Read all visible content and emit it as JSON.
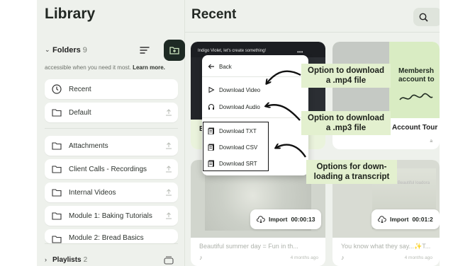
{
  "sidebar": {
    "title": "Library",
    "folders_label": "Folders",
    "folders_count": "9",
    "accessible_prefix": "accessible when you need it most. ",
    "accessible_link": "Learn more.",
    "items": [
      {
        "label": "Recent"
      },
      {
        "label": "Default"
      },
      {
        "label": "Attachments"
      },
      {
        "label": "Client Calls - Recordings"
      },
      {
        "label": "Internal Videos"
      },
      {
        "label": "Module 1: Baking Tutorials"
      },
      {
        "label": "Module 2: Bread Basics"
      }
    ],
    "playlists_label": "Playlists",
    "playlists_count": "2"
  },
  "main": {
    "title": "Recent",
    "card1": {
      "header_text": "Indigo Violet, let's create something!",
      "b_label": "B"
    },
    "card2": {
      "slide_title": "Membersh account to",
      "title": "Account Tour",
      "date_frag": "a"
    },
    "card3": {
      "import_label": "Import",
      "duration": "00:00:13",
      "title": "Beautiful summer day = Fun in th...",
      "date": "4 months ago"
    },
    "card4": {
      "import_label": "Import",
      "duration": "00:01:2",
      "title": "You know what they say...✨T...",
      "date": "4 months ago",
      "overlay_text": "Beautiful loadora"
    }
  },
  "menu": {
    "back_label": "Back",
    "items": [
      {
        "label": "Download Video"
      },
      {
        "label": "Download Audio"
      },
      {
        "label": "Download TXT"
      },
      {
        "label": "Download CSV"
      },
      {
        "label": "Download SRT"
      }
    ]
  },
  "annotations": {
    "mp4": "Option to download a .mp4 file",
    "mp3": "Option to download a .mp3 file",
    "transcript": "Options for down-loading a transcript"
  },
  "colors": {
    "accent_dark": "#1e2a24",
    "callout_bg": "#e3f0cf",
    "panel_bg": "#eef1ec"
  }
}
